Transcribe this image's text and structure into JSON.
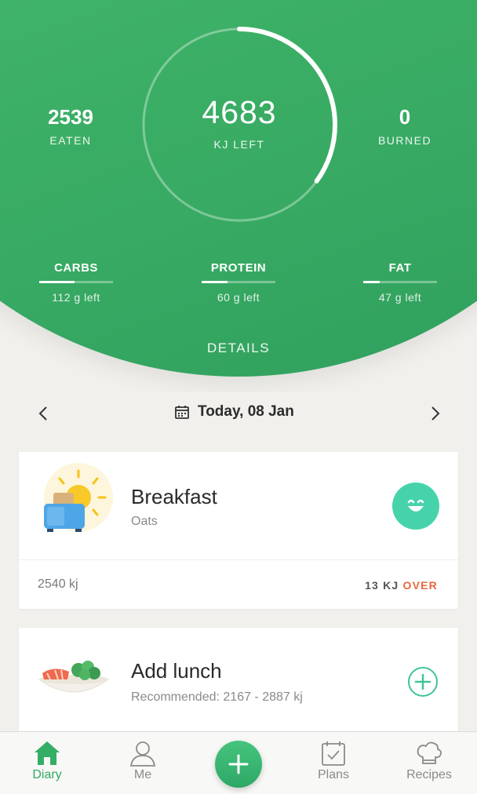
{
  "summary": {
    "eaten_value": "2539",
    "eaten_label": "EATEN",
    "left_value": "4683",
    "left_label": "KJ LEFT",
    "burned_value": "0",
    "burned_label": "BURNED",
    "ring_progress": 0.35
  },
  "macros": [
    {
      "name": "CARBS",
      "left": "112 g left",
      "progress": 0.48
    },
    {
      "name": "PROTEIN",
      "left": "60 g left",
      "progress": 0.35
    },
    {
      "name": "FAT",
      "left": "47 g left",
      "progress": 0.22
    }
  ],
  "details_label": "DETAILS",
  "date_nav": {
    "label": "Today, 08 Jan"
  },
  "meals": {
    "breakfast": {
      "title": "Breakfast",
      "subtitle": "Oats",
      "kj": "2540 kj",
      "over_amount": "13 KJ",
      "over_label": "OVER"
    },
    "lunch": {
      "title": "Add lunch",
      "subtitle": "Recommended: 2167 - 2887  kj"
    }
  },
  "nav": {
    "diary": "Diary",
    "me": "Me",
    "plans": "Plans",
    "recipes": "Recipes"
  },
  "colors": {
    "brand_green": "#3fb368",
    "accent_teal": "#46d3ab",
    "over_orange": "#e8663d"
  },
  "icons": {
    "breakfast": "sun-toaster-icon",
    "lunch": "salad-plate-icon",
    "smile": "smile-icon",
    "add": "add-circle-icon"
  }
}
